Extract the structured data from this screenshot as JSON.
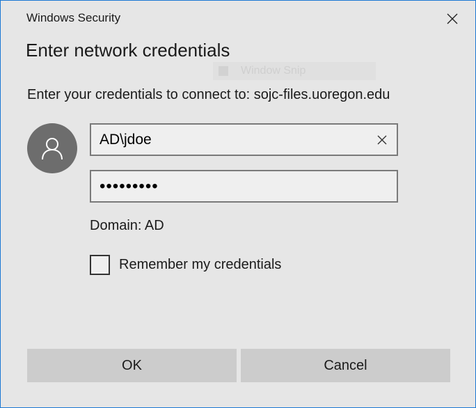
{
  "window": {
    "title": "Windows Security",
    "heading": "Enter network credentials",
    "subtitle": "Enter your credentials to connect to: sojc-files.uoregon.edu"
  },
  "background_window": {
    "label": "Window Snip"
  },
  "form": {
    "username": "AD\\jdoe",
    "password": "•••••••••",
    "domain": "Domain: AD",
    "remember_label": "Remember my credentials",
    "remember_checked": false
  },
  "buttons": {
    "ok": "OK",
    "cancel": "Cancel"
  },
  "icons": {
    "close": "close-icon",
    "clear": "clear-icon",
    "user": "user-icon"
  },
  "colors": {
    "window_border": "#1a78d4",
    "background": "#e6e6e6",
    "avatar": "#6d6d6d",
    "button": "#cccccc"
  }
}
